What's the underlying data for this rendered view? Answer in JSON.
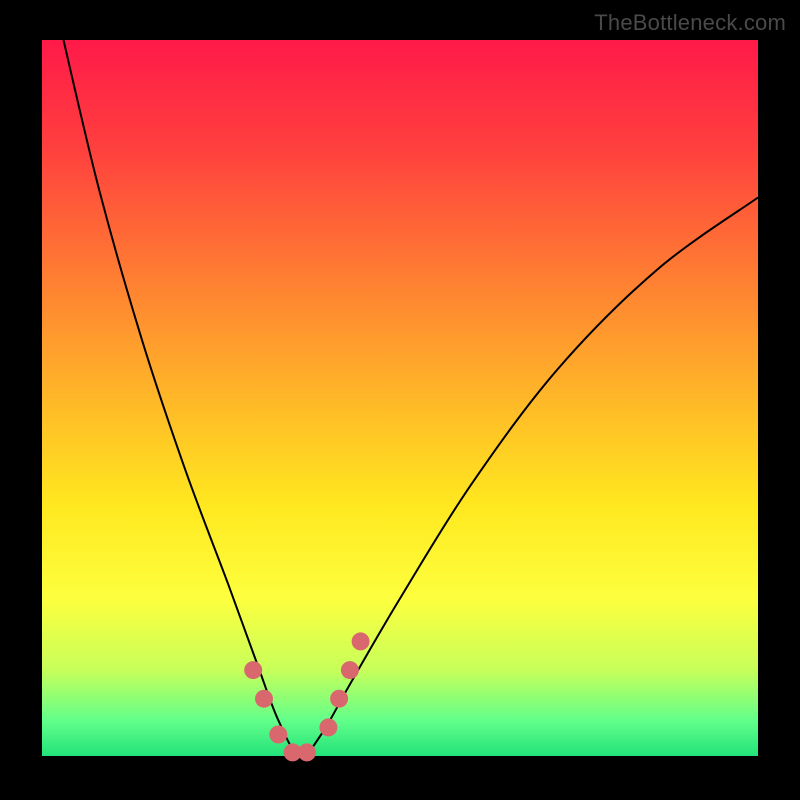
{
  "watermark": "TheBottleneck.com",
  "colors": {
    "black": "#000000",
    "curve": "#000000",
    "marker": "#d9686e",
    "grad_top": "#ff1a49",
    "grad_mid": "#ffe81f",
    "grad_bottom": "#22e27a"
  },
  "chart_data": {
    "type": "line",
    "title": "",
    "xlabel": "",
    "ylabel": "",
    "xlim": [
      0,
      100
    ],
    "ylim": [
      0,
      100
    ],
    "x_min_point": 36,
    "series": [
      {
        "name": "curve",
        "x": [
          3,
          8,
          14,
          20,
          26,
          30,
          33,
          36,
          39,
          43,
          50,
          60,
          72,
          86,
          100
        ],
        "y": [
          100,
          79,
          58,
          40,
          24,
          13,
          5,
          0,
          3,
          10,
          22,
          38,
          54,
          68,
          78
        ]
      }
    ],
    "markers": {
      "x": [
        29.5,
        31,
        33,
        35,
        37,
        40,
        41.5,
        43,
        44.5
      ],
      "y": [
        12,
        8,
        3,
        0.5,
        0.5,
        4,
        8,
        12,
        16
      ]
    }
  }
}
